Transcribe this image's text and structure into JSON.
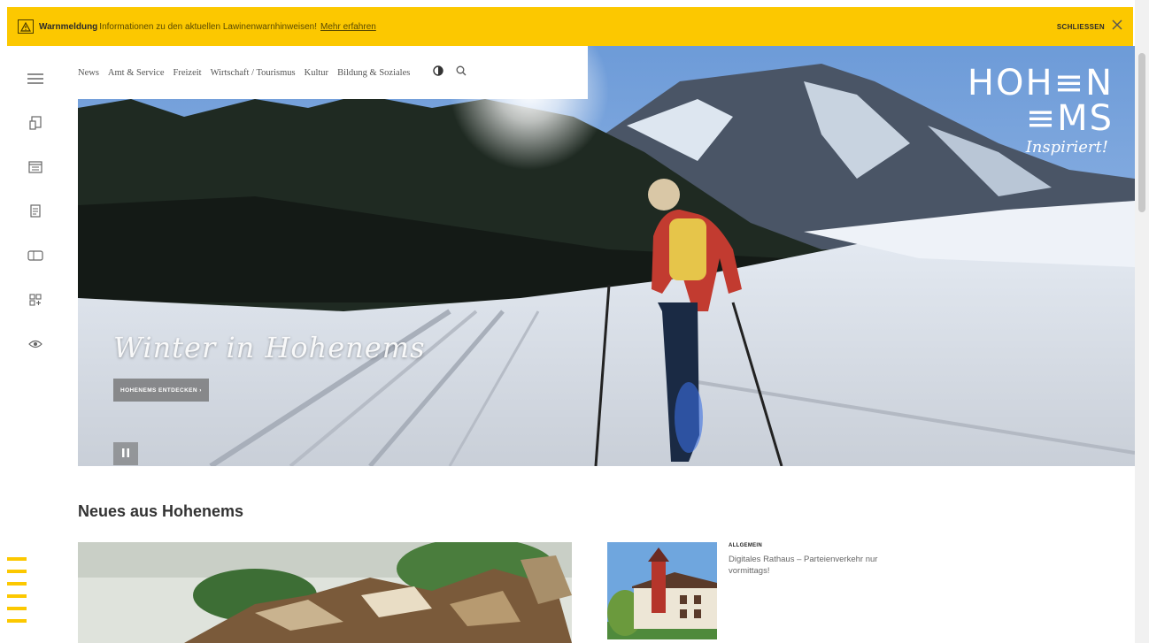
{
  "banner": {
    "title": "Warnmeldung",
    "text": "Informationen zu den aktuellen Lawinenwarnhinweisen!",
    "link": "Mehr erfahren",
    "close_label": "SCHLIESSEN",
    "icon": "warning-icon",
    "color": "#fcc800"
  },
  "nav": {
    "items": [
      "News",
      "Amt & Service",
      "Freizeit",
      "Wirtschaft / Tourismus",
      "Kultur",
      "Bildung & Soziales"
    ],
    "contrast_icon": "contrast-icon",
    "search_icon": "search-icon",
    "menu_icon": "menu-icon"
  },
  "sidebar": {
    "icons": [
      "document-icon",
      "calendar-icon",
      "forms-icon",
      "ticket-icon",
      "apps-icon",
      "eye-icon"
    ]
  },
  "logo": {
    "line1": "HOH≡N",
    "line2": "≡MS",
    "tagline": "Inspiriert!"
  },
  "hero": {
    "title": "Winter in Hohenems",
    "button": "HOHENEMS ENTDECKEN ›",
    "pause_icon": "pause-icon"
  },
  "news": {
    "heading": "Neues aus Hohenems",
    "side_category": "ALLGEMEIN",
    "side_title": "Digitales Rathaus – Parteienverkehr nur vormittags!"
  }
}
